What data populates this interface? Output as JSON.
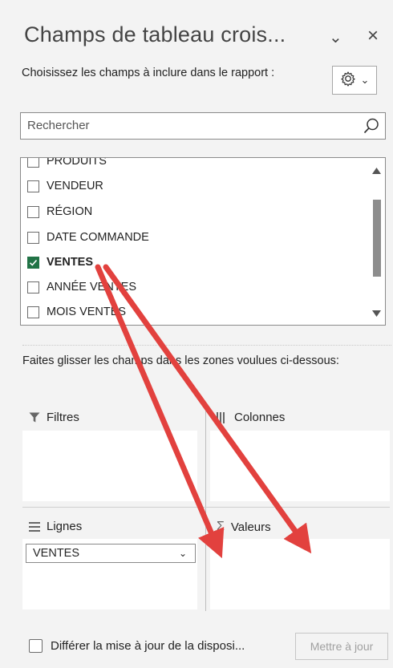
{
  "pane": {
    "title": "Champs de tableau crois...",
    "chevron": "⌄",
    "close": "×",
    "subtitle": "Choisissez les champs à inclure dans le rapport :",
    "gear_chevron": "⌄"
  },
  "search": {
    "placeholder": "Rechercher"
  },
  "fields": [
    {
      "label": "PRODUITS",
      "checked": false
    },
    {
      "label": "VENDEUR",
      "checked": false
    },
    {
      "label": "RÉGION",
      "checked": false
    },
    {
      "label": "DATE COMMANDE",
      "checked": false
    },
    {
      "label": "VENTES",
      "checked": true
    },
    {
      "label": "ANNÉE VENTES",
      "checked": false
    },
    {
      "label": "MOIS VENTES",
      "checked": false
    }
  ],
  "areas": {
    "instructions": "Faites glisser les champs dans les zones voulues ci-dessous:",
    "filters": "Filtres",
    "columns": "Colonnes",
    "rows": "Lignes",
    "values": "Valeurs",
    "rows_item": "VENTES",
    "rows_item_chevron": "⌄"
  },
  "footer": {
    "defer_label": "Différer la mise à jour de la disposi...",
    "update_button": "Mettre à jour"
  },
  "colors": {
    "checked": "#217346",
    "annotation_arrow": "#e2413e"
  },
  "icons": [
    "gear-icon",
    "search-icon",
    "filter-icon",
    "columns-icon",
    "rows-icon",
    "sigma-icon",
    "checkmark-icon"
  ]
}
